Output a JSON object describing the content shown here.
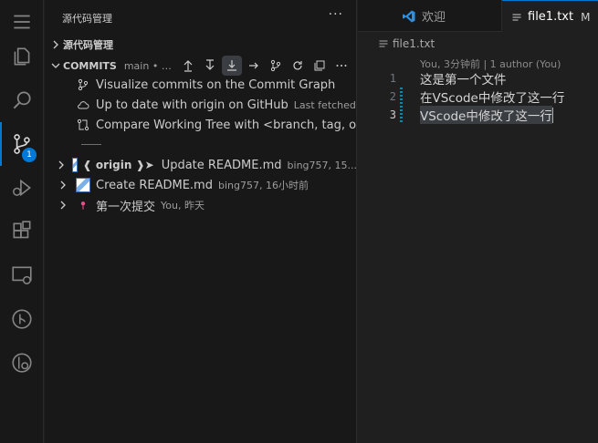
{
  "activity_bar": {
    "items": [
      {
        "icon": "menu-icon"
      },
      {
        "icon": "explorer-icon"
      },
      {
        "icon": "search-icon"
      },
      {
        "icon": "source-control-icon",
        "badge": "1"
      },
      {
        "icon": "run-debug-icon"
      },
      {
        "icon": "extensions-icon"
      },
      {
        "icon": "remote-explorer-icon"
      },
      {
        "icon": "git-graph-icon"
      },
      {
        "icon": "gitlens-icon"
      }
    ]
  },
  "sidebar": {
    "title": "源代码管理",
    "more": "···",
    "repos_section": "源代码管理",
    "commits_section": {
      "label": "COMMITS",
      "meta": "main • Last f..."
    },
    "actions": [
      {
        "label": "Visualize commits on the Commit Graph",
        "desc": ""
      },
      {
        "label": "Up to date with origin on GitHub",
        "desc": "Last fetched ..."
      },
      {
        "label": "Compare Working Tree with <branch, tag, or r...",
        "desc": ""
      }
    ],
    "commits": [
      {
        "ref": "❰ origin ❱➤",
        "label": "Update README.md",
        "desc": "bing757, 15..."
      },
      {
        "ref": "",
        "label": "Create README.md",
        "desc": "bing757, 16小时前"
      },
      {
        "ref": "",
        "label": "第一次提交",
        "desc": "You, 昨天"
      }
    ]
  },
  "editor": {
    "tabs": [
      {
        "label": "欢迎",
        "modified": ""
      },
      {
        "label": "file1.txt",
        "modified": "M"
      }
    ],
    "breadcrumb": "file1.txt",
    "blame": "You, 3分钟前 | 1 author (You)",
    "lines": [
      {
        "num": "1",
        "text": "这是第一个文件"
      },
      {
        "num": "2",
        "text": "在VScode中修改了这一行"
      },
      {
        "num": "3",
        "text": "VScode中修改了这一行"
      }
    ]
  },
  "colors": {
    "accent": "#0078d4",
    "background": "#1f1f1f",
    "sidebar": "#181818"
  }
}
